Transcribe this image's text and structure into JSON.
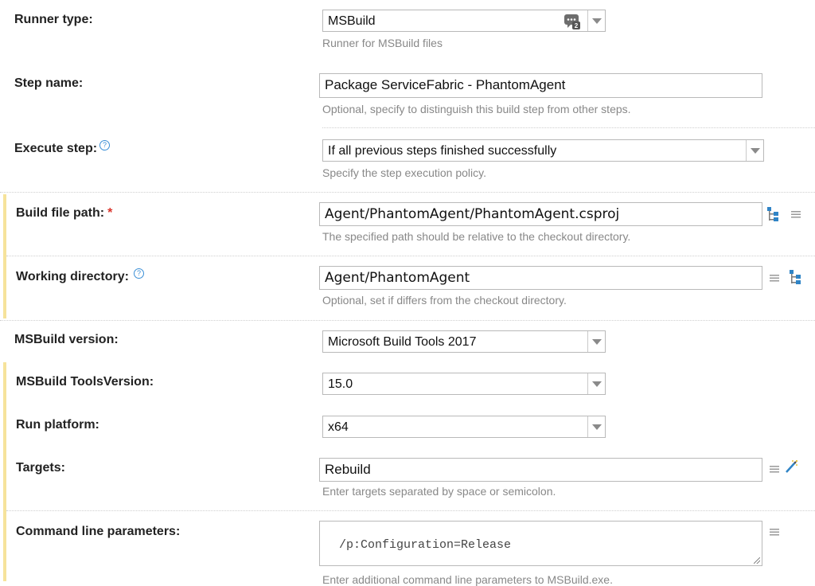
{
  "fields": {
    "runner_type": {
      "label": "Runner type:",
      "value": "MSBuild",
      "note": "Runner for MSBuild files",
      "badge": "2"
    },
    "step_name": {
      "label": "Step name:",
      "value": "Package ServiceFabric - PhantomAgent",
      "note": "Optional, specify to distinguish this build step from other steps."
    },
    "execute_step": {
      "label": "Execute step:",
      "value": "If all previous steps finished successfully",
      "note": "Specify the step execution policy."
    },
    "build_file_path": {
      "label": "Build file path:",
      "required": "*",
      "value": "Agent/PhantomAgent/PhantomAgent.csproj",
      "note": "The specified path should be relative to the checkout directory."
    },
    "working_directory": {
      "label": "Working directory:",
      "value": "Agent/PhantomAgent",
      "note": "Optional, set if differs from the checkout directory."
    },
    "msbuild_version": {
      "label": "MSBuild version:",
      "value": "Microsoft Build Tools 2017"
    },
    "tools_version": {
      "label": "MSBuild ToolsVersion:",
      "value": "15.0"
    },
    "run_platform": {
      "label": "Run platform:",
      "value": "x64"
    },
    "targets": {
      "label": "Targets:",
      "value": "Rebuild",
      "note": "Enter targets separated by space or semicolon."
    },
    "command_line": {
      "label": "Command line parameters:",
      "value": "/p:Configuration=Release",
      "note": "Enter additional command line parameters to MSBuild.exe."
    }
  },
  "icons": {
    "help": "help-circle-icon",
    "tree": "file-tree-icon",
    "list": "text-list-icon",
    "magic": "magic-wand-icon"
  },
  "colors": {
    "highlight_bar": "#f6e39b",
    "help_blue": "#3b8fd6",
    "required_red": "#d9342b"
  }
}
